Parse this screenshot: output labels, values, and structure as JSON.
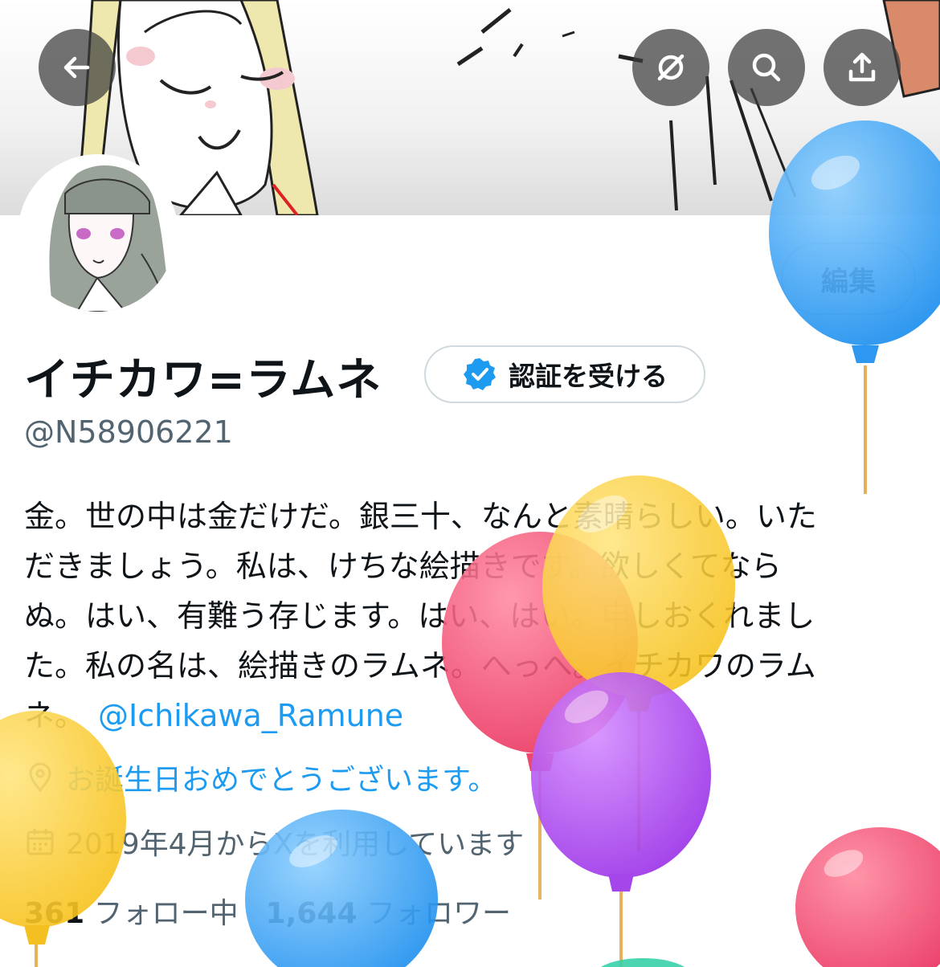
{
  "header": {
    "back_icon": "arrow-left-icon",
    "mute_icon": "notifications-off-icon",
    "search_icon": "search-icon",
    "share_icon": "share-icon"
  },
  "profile": {
    "edit_label": "編集",
    "display_name": "イチカワ=ラムネ",
    "verify_label": "認証を受ける",
    "handle": "@N58906221",
    "bio_lines": [
      "金。世の中は金だけだ。銀三十、なんと素晴らしい。いた",
      "だきましょう。私は、けちな絵描きです。欲しくてなら",
      "ぬ。はい、有難う存じます。はい、はい。申しおくれまし",
      "た。私の名は、絵描きのラムネ。へっへ。イチカワのラム",
      "ネ。"
    ],
    "bio_mention": "@Ichikawa_Ramune",
    "birthday_text": "お誕生日おめでとうございます。",
    "joined_text": "2019年4月からXを利用しています",
    "following_count": "361",
    "following_label": "フォロー中",
    "followers_count": "1,644",
    "followers_label": "フォロワー"
  },
  "colors": {
    "accent": "#1d9bf0",
    "secondary_text": "#536471",
    "primary_text": "#0f1419",
    "border": "#cfd9de"
  }
}
